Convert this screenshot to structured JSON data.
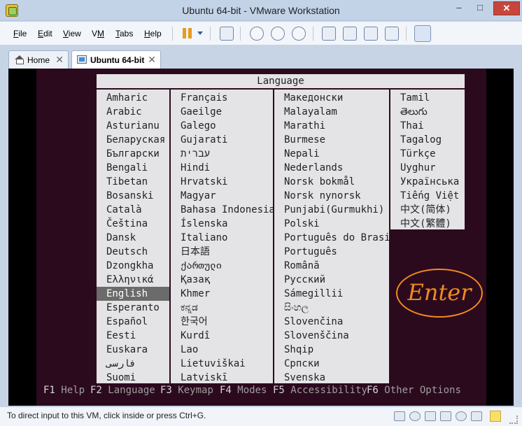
{
  "window": {
    "title": "Ubuntu 64-bit - VMware Workstation",
    "minimize_glyph": "–",
    "maximize_glyph": "□",
    "close_glyph": "✕"
  },
  "menu": [
    {
      "pre": "",
      "u": "F",
      "post": "ile"
    },
    {
      "pre": "",
      "u": "E",
      "post": "dit"
    },
    {
      "pre": "",
      "u": "V",
      "post": "iew"
    },
    {
      "pre": "V",
      "u": "M",
      "post": ""
    },
    {
      "pre": "",
      "u": "T",
      "post": "abs"
    },
    {
      "pre": "",
      "u": "H",
      "post": "elp"
    }
  ],
  "tabs": {
    "home": {
      "label": "Home",
      "close": "✕"
    },
    "vm": {
      "label": "Ubuntu 64-bit",
      "close": "✕"
    }
  },
  "language_panel": {
    "header": "Language",
    "columns": [
      [
        "Amharic",
        "Arabic",
        "Asturianu",
        "Беларуская",
        "Български",
        "Bengali",
        "Tibetan",
        "Bosanski",
        "Català",
        "Čeština",
        "Dansk",
        "Deutsch",
        "Dzongkha",
        "Ελληνικά",
        "English",
        "Esperanto",
        "Español",
        "Eesti",
        "Euskara",
        "فارسی",
        "Suomi"
      ],
      [
        "Français",
        "Gaeilge",
        "Galego",
        "Gujarati",
        "עברית",
        "Hindi",
        "Hrvatski",
        "Magyar",
        "Bahasa Indonesia",
        "Íslenska",
        "Italiano",
        "日本語",
        "ქართული",
        "Қазақ",
        "Khmer",
        "ಕನ್ನಡ",
        "한국어",
        "Kurdî",
        "Lao",
        "Lietuviškai",
        "Latviskī"
      ],
      [
        "Македонски",
        "Malayalam",
        "Marathi",
        "Burmese",
        "Nepali",
        "Nederlands",
        "Norsk bokmål",
        "Norsk nynorsk",
        "Punjabi(Gurmukhi)",
        "Polski",
        "Português do Brasil",
        "Português",
        "Română",
        "Русский",
        "Sámegillii",
        "සිංහල",
        "Slovenčina",
        "Slovenščina",
        "Shqip",
        "Српски",
        "Svenska"
      ],
      [
        "Tamil",
        "తెలుగు",
        "Thai",
        "Tagalog",
        "Türkçe",
        "Uyghur",
        "Українська",
        "Tiếng Việt",
        "中文(简体)",
        "中文(繁體)"
      ]
    ],
    "selected": "English"
  },
  "function_keys": [
    {
      "key": "F1",
      "label": "Help"
    },
    {
      "key": "F2",
      "label": "Language"
    },
    {
      "key": "F3",
      "label": "Keymap"
    },
    {
      "key": "F4",
      "label": "Modes"
    },
    {
      "key": "F5",
      "label": "Accessibility"
    },
    {
      "key": "F6",
      "label": "Other Options"
    }
  ],
  "annotation": "Enter",
  "annotation_color": "#ef8c1b",
  "statusbar": {
    "text": "To direct input to this VM, click inside or press Ctrl+G."
  },
  "icons": [
    "pause-icon",
    "send-ctrl-alt-del-icon",
    "snapshot-icon",
    "revert-snapshot-icon",
    "snapshot-manager-icon",
    "show-library-icon",
    "normal-view-icon",
    "full-screen-icon",
    "unity-icon",
    "console-view-icon",
    "home-icon",
    "vm-icon",
    "hard-disk-icon",
    "cd-dvd-icon",
    "network-icon",
    "usb-icon",
    "sound-icon",
    "display-icon",
    "message-log-icon"
  ]
}
